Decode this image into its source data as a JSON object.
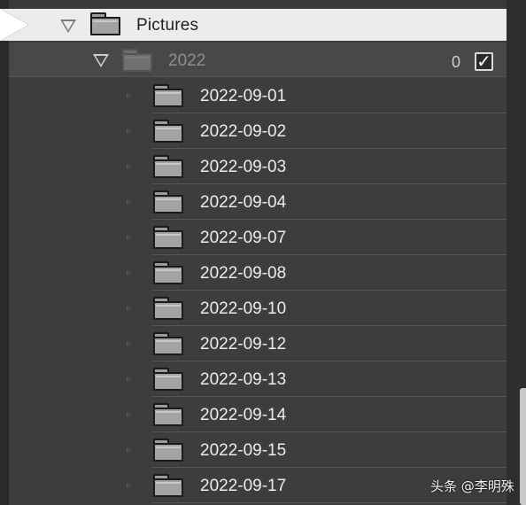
{
  "tree": {
    "root": {
      "label": "Pictures",
      "icon": "folder-icon",
      "expanded": true,
      "selected": true
    },
    "year": {
      "label": "2022",
      "count": "0",
      "checked": true,
      "expanded": true,
      "icon": "folder-icon"
    },
    "children": [
      {
        "label": "2022-09-01"
      },
      {
        "label": "2022-09-02"
      },
      {
        "label": "2022-09-03"
      },
      {
        "label": "2022-09-04"
      },
      {
        "label": "2022-09-07"
      },
      {
        "label": "2022-09-08"
      },
      {
        "label": "2022-09-10"
      },
      {
        "label": "2022-09-12"
      },
      {
        "label": "2022-09-13"
      },
      {
        "label": "2022-09-14"
      },
      {
        "label": "2022-09-15"
      },
      {
        "label": "2022-09-17"
      }
    ]
  },
  "watermark": {
    "text": "头条 @李明殊"
  },
  "colors": {
    "panel_bg": "#3d3d3d",
    "selected_row_bg": "#ececec",
    "text_light": "#ececec",
    "text_dim": "#8e8e8e"
  }
}
